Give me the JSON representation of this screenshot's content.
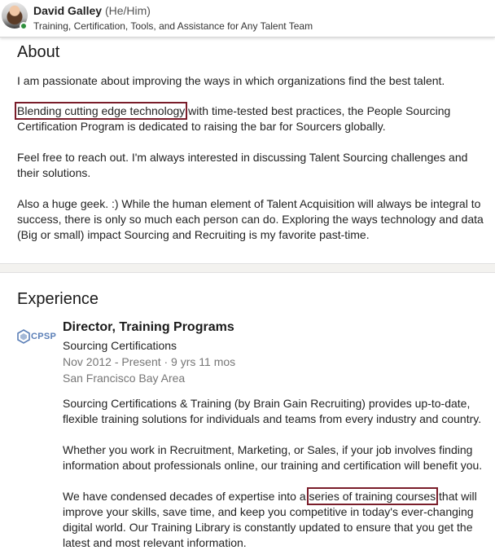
{
  "profile": {
    "name": "David Galley",
    "pronouns": "(He/Him)",
    "headline": "Training, Certification, Tools, and Assistance for Any Talent Team",
    "status_color": "#2f8f3c"
  },
  "about": {
    "title": "About",
    "p1": "I am passionate about improving the ways in which organizations find the best talent.",
    "p2_highlight": "Blending cutting edge technology",
    "p2_rest": " with time-tested best practices, the People Sourcing Certification Program is dedicated to raising the bar for Sourcers globally.",
    "p3": "Feel free to reach out. I'm always interested in discussing Talent Sourcing challenges and their solutions.",
    "p4": "Also a huge geek. :) While the human element of Talent Acquisition will always be integral to success, there is only so much each person can do. Exploring the ways technology and data (Big or small) impact Sourcing and Recruiting is my favorite past-time."
  },
  "experience": {
    "title": "Experience",
    "logo_text": "CPSP",
    "job_title": "Director, Training Programs",
    "company": "Sourcing Certifications",
    "dates": "Nov 2012 - Present · 9 yrs 11 mos",
    "location": "San Francisco Bay Area",
    "d1": "Sourcing Certifications & Training (by Brain Gain Recruiting) provides up-to-date, flexible training solutions for individuals and teams from every industry and country.",
    "d2": "Whether you work in Recruitment, Marketing, or Sales, if your job involves finding information about professionals online, our training and certification will benefit you.",
    "d3_before": "We have condensed decades of expertise into a ",
    "d3_highlight": "series of training courses",
    "d3_after": " that will improve your skills, save time, and keep you competitive in today's ever-changing digital world. Our Training Library is constantly updated to ensure that you get the latest and most relevant information."
  },
  "colors": {
    "highlight_box": "#7a1d2a",
    "muted_text": "#767676",
    "logo_blue": "#5b7fb7"
  }
}
